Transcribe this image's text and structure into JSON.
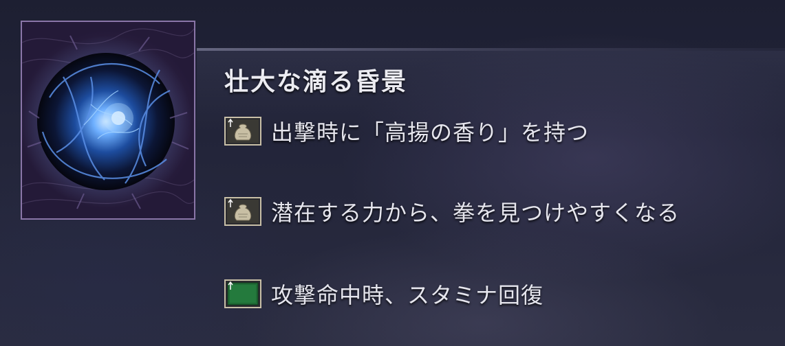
{
  "item": {
    "name": "壮大な滴る昏景",
    "image_icon": "dark-blue-orb-icon",
    "frame_color": "#8a76a8"
  },
  "effects": [
    {
      "icon": "pouch-up-icon",
      "text": "出撃時に「高揚の香り」を持つ"
    },
    {
      "icon": "pouch-up-icon",
      "text": "潜在する力から、拳を見つけやすくなる"
    },
    {
      "icon": "green-square-up-icon",
      "text": "攻撃命中時、スタミナ回復"
    }
  ],
  "colors": {
    "background": "#1a1b2b",
    "text": "#e6e6ee",
    "icon_frame": "#c9c0a8",
    "stamina_green": "#1f6b35"
  }
}
